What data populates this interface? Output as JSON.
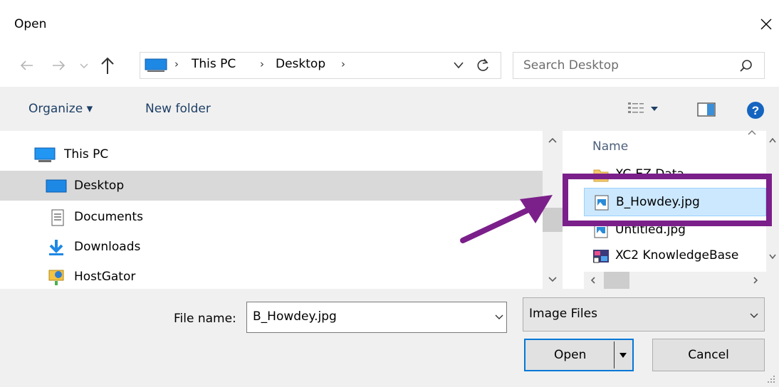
{
  "window": {
    "title": "Open",
    "close_glyph": "✕"
  },
  "address": {
    "breadcrumb": [
      "This PC",
      "Desktop"
    ],
    "separator": "›",
    "nav_back_icon": "back-arrow-icon",
    "nav_forward_icon": "forward-arrow-icon",
    "nav_up_icon": "up-arrow-icon"
  },
  "search": {
    "placeholder": "Search Desktop"
  },
  "toolbar": {
    "organize_label": "Organize ▾",
    "new_folder_label": "New folder"
  },
  "nav": {
    "items": [
      {
        "label": "This PC",
        "icon": "computer-icon"
      },
      {
        "label": "Desktop",
        "icon": "desktop-icon",
        "selected": true
      },
      {
        "label": "Documents",
        "icon": "documents-icon"
      },
      {
        "label": "Downloads",
        "icon": "downloads-icon"
      },
      {
        "label": "HostGator",
        "icon": "network-location-icon"
      }
    ]
  },
  "files": {
    "column_name": "Name",
    "items": [
      {
        "label": "XC-EZ Data",
        "icon": "folder-icon"
      },
      {
        "label": "B_Howdey.jpg",
        "icon": "image-file-icon",
        "selected": true
      },
      {
        "label": "Untitled.jpg",
        "icon": "image-file-icon"
      },
      {
        "label": "XC2 KnowledgeBase",
        "icon": "shortcut-icon"
      }
    ]
  },
  "footer": {
    "filename_label": "File name:",
    "filename_value": "B_Howdey.jpg",
    "filter_value": "Image Files",
    "open_label": "Open",
    "cancel_label": "Cancel"
  },
  "colors": {
    "annotation": "#7b1f8a",
    "selection": "#cce8ff",
    "accent": "#0078d7",
    "link": "#1e3f66"
  }
}
